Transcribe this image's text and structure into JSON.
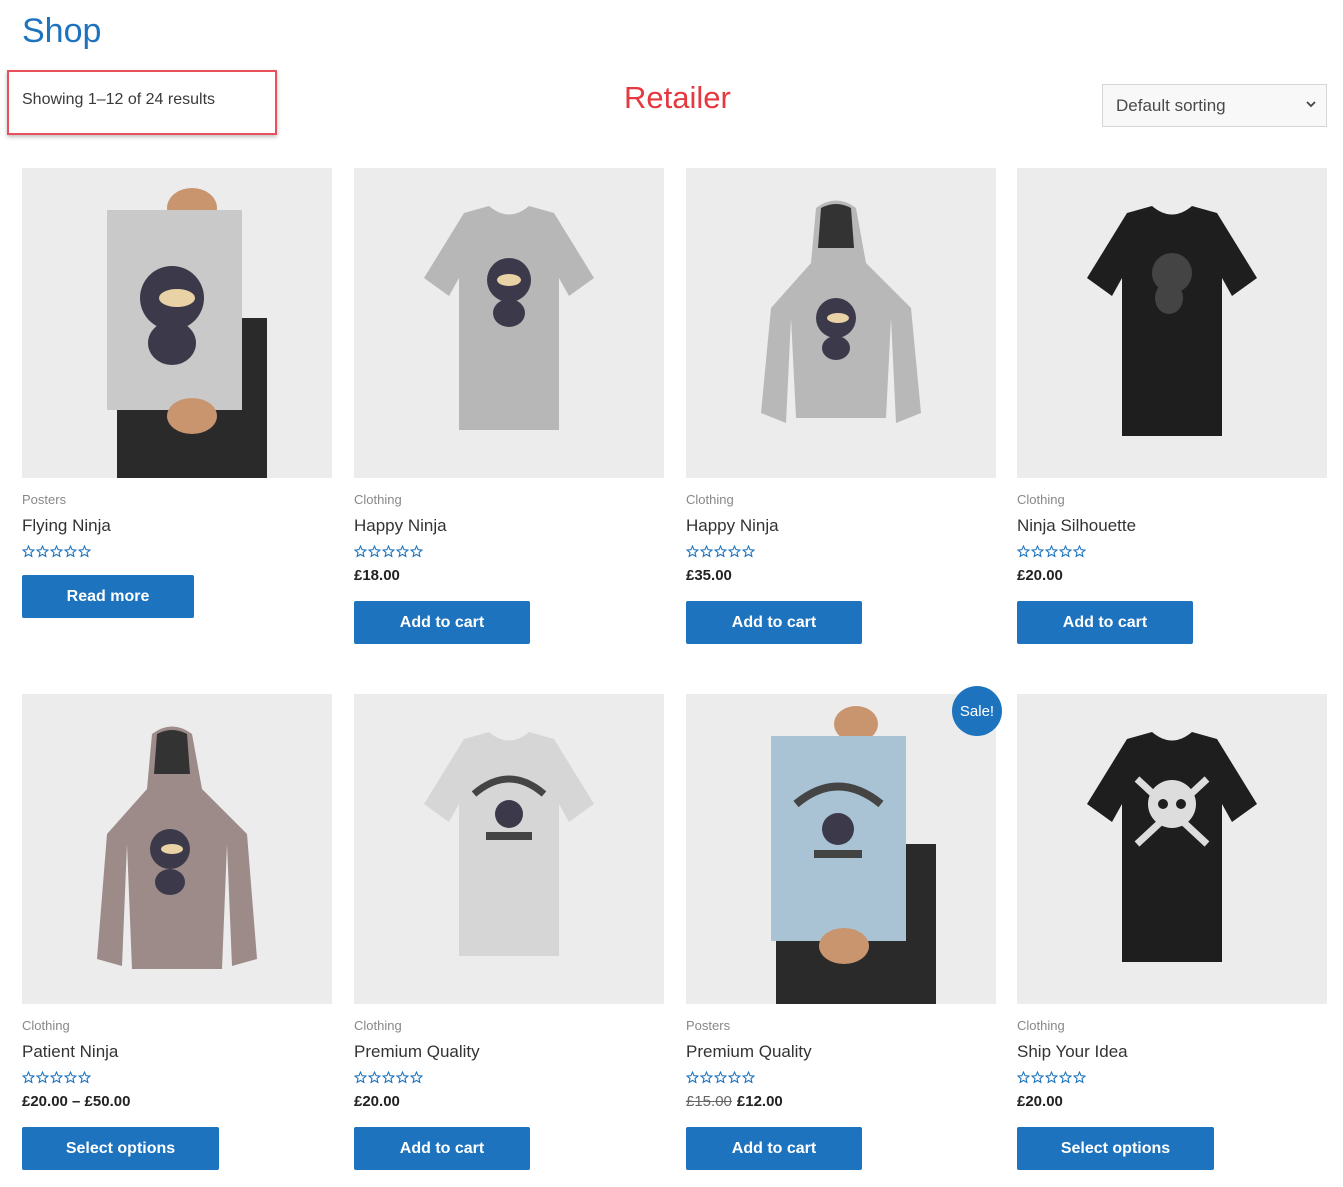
{
  "page": {
    "title": "Shop"
  },
  "toolbar": {
    "result_count": "Showing 1–12 of 24 results",
    "annotation": "Retailer",
    "sorting": {
      "selected": "Default sorting"
    }
  },
  "colors": {
    "accent": "#1e73be",
    "annotation": "#e5383f",
    "image_bg": "#ececec"
  },
  "products": [
    {
      "category": "Posters",
      "name": "Flying Ninja",
      "price": "",
      "old_price": "",
      "button": "Read more",
      "rating_stars": 5,
      "image": "poster-ninja-icon"
    },
    {
      "category": "Clothing",
      "name": "Happy Ninja",
      "price": "£18.00",
      "old_price": "",
      "button": "Add to cart",
      "rating_stars": 5,
      "image": "grey-tshirt-icon"
    },
    {
      "category": "Clothing",
      "name": "Happy Ninja",
      "price": "£35.00",
      "old_price": "",
      "button": "Add to cart",
      "rating_stars": 5,
      "image": "grey-hoodie-icon"
    },
    {
      "category": "Clothing",
      "name": "Ninja Silhouette",
      "price": "£20.00",
      "old_price": "",
      "button": "Add to cart",
      "rating_stars": 5,
      "image": "black-tshirt-icon"
    },
    {
      "category": "Clothing",
      "name": "Patient Ninja",
      "price": "£20.00 – £50.00",
      "old_price": "",
      "button": "Select options",
      "rating_stars": 5,
      "image": "mauve-hoodie-icon"
    },
    {
      "category": "Clothing",
      "name": "Premium Quality",
      "price": "£20.00",
      "old_price": "",
      "button": "Add to cart",
      "rating_stars": 5,
      "image": "white-tshirt-icon"
    },
    {
      "category": "Posters",
      "name": "Premium Quality",
      "price": "£12.00",
      "old_price": "£15.00",
      "button": "Add to cart",
      "rating_stars": 5,
      "image": "blue-poster-icon",
      "sale": "Sale!"
    },
    {
      "category": "Clothing",
      "name": "Ship Your Idea",
      "price": "£20.00",
      "old_price": "",
      "button": "Select options",
      "rating_stars": 5,
      "image": "skull-tshirt-icon"
    }
  ]
}
